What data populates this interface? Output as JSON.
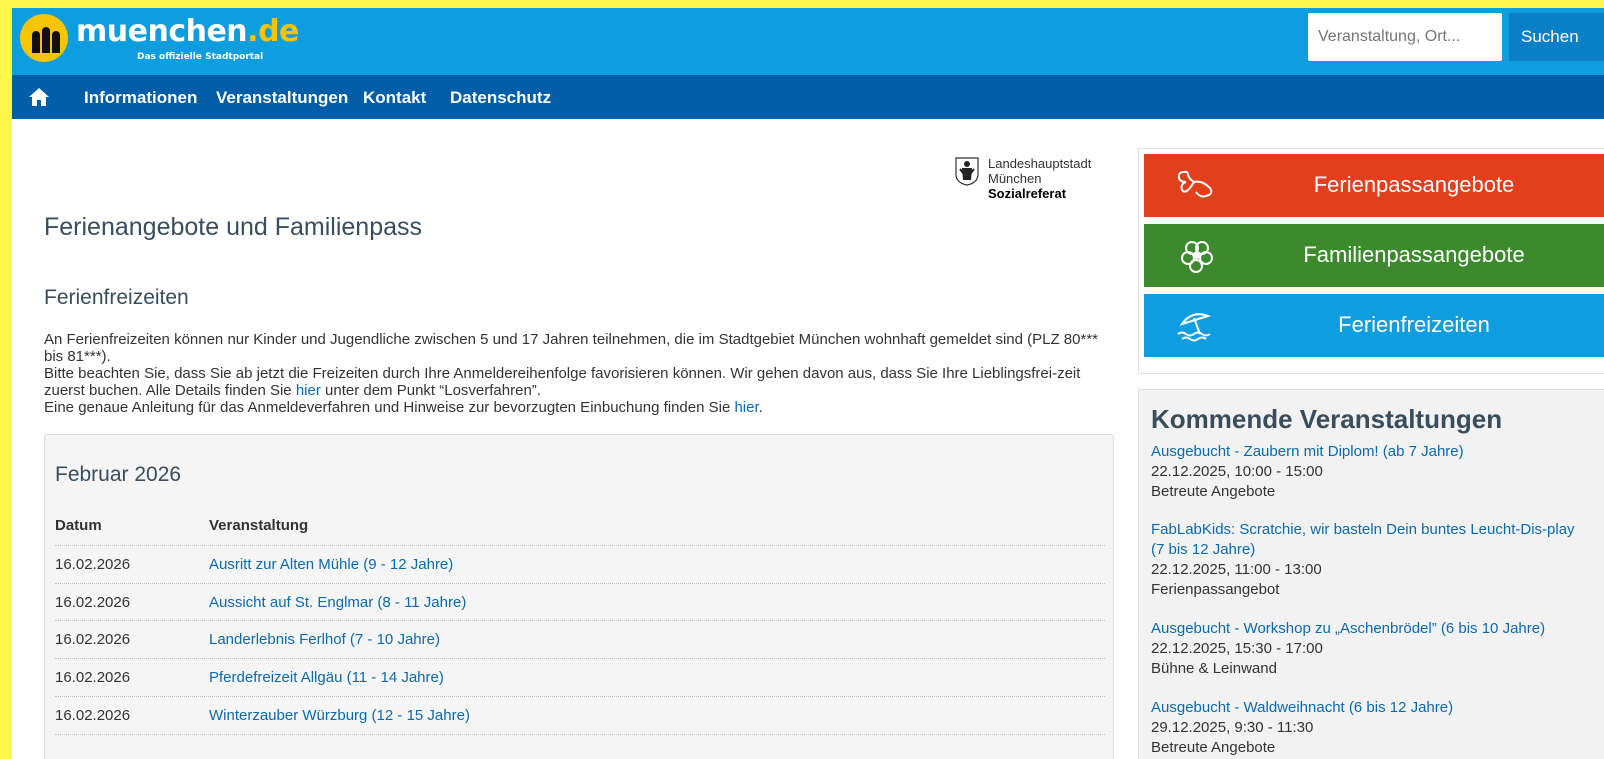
{
  "header": {
    "logo_main": "muenchen",
    "logo_dot": ".de",
    "logo_sub": "Das offizielle Stadtportal",
    "search_placeholder": "Veranstaltung, Ort...",
    "search_button": "Suchen"
  },
  "nav": {
    "items": [
      "Informationen",
      "Veranstaltungen",
      "Kontakt",
      "Datenschutz"
    ]
  },
  "sozial": {
    "line1": "Landeshauptstadt",
    "line2": "München",
    "line3": "Sozialreferat"
  },
  "main": {
    "title": "Ferienangebote und Familienpass",
    "section": "Ferienfreizeiten",
    "intro_p1": "An Ferienfreizeiten können nur Kinder und Jugendliche zwischen 5 und 17 Jahren teilnehmen, die im Stadtgebiet München wohnhaft gemeldet sind (PLZ 80*** bis 81***).",
    "intro_p2a": "Bitte beachten Sie, dass Sie ab jetzt die Freizeiten durch Ihre Anmeldereihenfolge favorisieren können. Wir gehen davon aus, dass Sie Ihre Lieblingsfrei-zeit zuerst buchen. Alle Details finden Sie ",
    "intro_link1": "hier",
    "intro_p2b": " unter dem Punkt “Losverfahren”.",
    "intro_p3a": "Eine genaue Anleitung für das Anmeldeverfahren und Hinweise zur bevorzugten Einbuchung finden Sie ",
    "intro_link2": "hier",
    "intro_p3b": "."
  },
  "table": {
    "month": "Februar 2026",
    "col_date": "Datum",
    "col_event": "Veranstaltung",
    "rows": [
      {
        "date": "16.02.2026",
        "event": "Ausritt zur Alten Mühle (9 - 12 Jahre)"
      },
      {
        "date": "16.02.2026",
        "event": "Aussicht auf St. Englmar (8 - 11 Jahre)"
      },
      {
        "date": "16.02.2026",
        "event": "Landerlebnis Ferlhof (7 - 10 Jahre)"
      },
      {
        "date": "16.02.2026",
        "event": "Pferdefreizeit Allgäu (11 - 14 Jahre)"
      },
      {
        "date": "16.02.2026",
        "event": "Winterzauber Würzburg (12 - 15 Jahre)"
      }
    ]
  },
  "tiles": [
    {
      "label": "Ferienpassangebote",
      "color": "#e2401c",
      "icon": "butterfly-icon"
    },
    {
      "label": "Familienpassangebote",
      "color": "#3d8a2e",
      "icon": "flower-icon"
    },
    {
      "label": "Ferienfreizeiten",
      "color": "#0e9ee0",
      "icon": "beach-umbrella-icon"
    }
  ],
  "events": {
    "title": "Kommende Veranstaltungen",
    "items": [
      {
        "title": "Ausgebucht - Zaubern mit Diplom! (ab 7 Jahre)",
        "date": "22.12.2025, 10:00 - 15:00",
        "category": "Betreute Angebote"
      },
      {
        "title": "FabLabKids: Scratchie, wir basteln Dein buntes Leucht-Dis-play (7 bis 12 Jahre)",
        "date": "22.12.2025, 11:00 - 13:00",
        "category": "Ferienpassangebot"
      },
      {
        "title": "Ausgebucht - Workshop zu „Aschenbrödel” (6 bis 10 Jahre)",
        "date": "22.12.2025, 15:30 - 17:00",
        "category": "Bühne & Leinwand"
      },
      {
        "title": "Ausgebucht - Waldweihnacht (6 bis 12 Jahre)",
        "date": "29.12.2025, 9:30 - 11:30",
        "category": "Betreute Angebote"
      }
    ]
  },
  "colors": {
    "header_blue": "#0e9ee0",
    "nav_blue": "#005ea8",
    "link_blue": "#0b6aae",
    "frame_yellow": "#fdf64a"
  }
}
